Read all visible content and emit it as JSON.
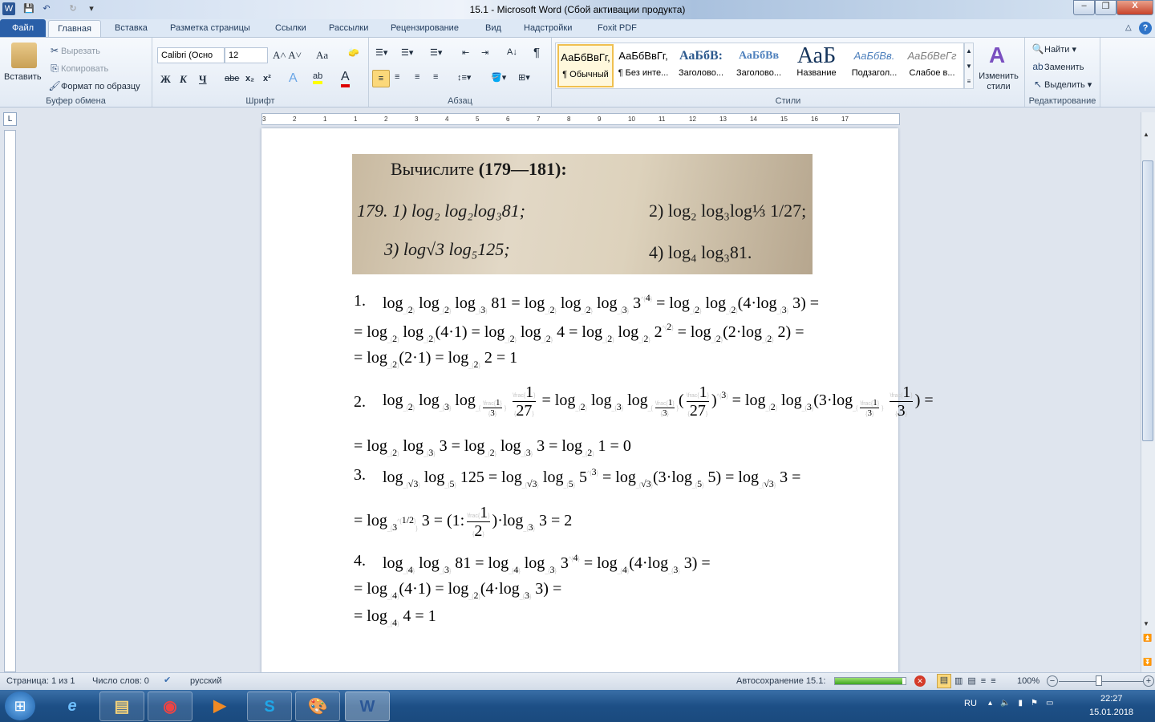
{
  "window": {
    "title": "15.1  -  Microsoft Word (Сбой активации продукта)",
    "min": "–",
    "max": "❐",
    "close": "X"
  },
  "tabs": [
    "Файл",
    "Главная",
    "Вставка",
    "Разметка страницы",
    "Ссылки",
    "Рассылки",
    "Рецензирование",
    "Вид",
    "Надстройки",
    "Foxit PDF"
  ],
  "clipboard": {
    "paste": "Вставить",
    "cut": "Вырезать",
    "copy": "Копировать",
    "format": "Формат по образцу",
    "label": "Буфер обмена"
  },
  "font": {
    "name": "Calibri (Осно",
    "size": "12",
    "label": "Шрифт",
    "bold": "Ж",
    "italic": "К",
    "underline": "Ч",
    "strike": "abe",
    "sub": "x₂",
    "sup": "x²",
    "case": "Aa"
  },
  "paragraph": {
    "label": "Абзац",
    "pilcrow": "¶"
  },
  "styles": {
    "label": "Стили",
    "items": [
      {
        "preview": "АаБбВвГг,",
        "name": "¶ Обычный"
      },
      {
        "preview": "АаБбВвГг,",
        "name": "¶ Без инте..."
      },
      {
        "preview": "АаБбВ:",
        "name": "Заголово..."
      },
      {
        "preview": "АаБбВв",
        "name": "Заголово..."
      },
      {
        "preview": "АаБ",
        "name": "Название"
      },
      {
        "preview": "АаБбВв.",
        "name": "Подзагол..."
      },
      {
        "preview": "АаБбВеГг",
        "name": "Слабое в..."
      }
    ],
    "change": "Изменить стили"
  },
  "editing": {
    "label": "Редактирование",
    "find": "Найти",
    "replace": "Заменить",
    "select": "Выделить"
  },
  "ruler_numbers": [
    "3",
    "2",
    "1",
    "1",
    "2",
    "3",
    "4",
    "5",
    "6",
    "7",
    "8",
    "9",
    "10",
    "11",
    "12",
    "13",
    "14",
    "15",
    "16",
    "17"
  ],
  "photo": {
    "heading": "Вычислите",
    "range": "(179—181):",
    "l1a": "179. 1) log₂ log₂log₃81;",
    "l1b": "2) log₂ log₃log⅓ 1/27;",
    "l2a": "3) log√3  log₅125;",
    "l2b": "4) log₄ log₃81."
  },
  "solutions": [
    {
      "num": "1.",
      "lines": [
        "log_{2} log_{2} log_{3} 81 = log_{2} log_{2} log_{3} 3^{4} = log_{2} log_{2}(4·log_{3} 3) =",
        "= log_{2} log_{2}(4·1) = log_{2} log_{2} 4 = log_{2} log_{2} 2^{2} = log_{2}(2·log_{2} 2) =",
        "= log_{2}(2·1) = log_{2} 2 = 1"
      ]
    },
    {
      "num": "2.",
      "lines": [
        "log_{2} log_{3} log_{\\frac{1}{3}} \\frac{1}{27} = log_{2} log_{3} log_{\\frac{1}{3}}(\\frac{1}{27})^{3} = log_{2} log_{3}(3·log_{\\frac{1}{3}} \\frac{1}{3}) =",
        "= log_{2} log_{3} 3 = log_{2} log_{3} 3 = log_{2} 1 = 0"
      ]
    },
    {
      "num": "3.",
      "lines": [
        "log_{√3} log_{5} 125 = log_{√3} log_{5} 5^{3} = log_{√3}(3·log_{5} 5) = log_{√3} 3 =",
        "= log_{3^{1/2}} 3 = (1:\\frac{1}{2})·log_{3} 3 = 2"
      ]
    },
    {
      "num": "4.",
      "lines": [
        "log_{4} log_{3} 81 = log_{4} log_{3} 3^{4} = log_{4}(4·log_{3} 3) =",
        "= log_{4}(4·1) = log_{2}(4·log_{3} 3) =",
        "= log_{4} 4 = 1"
      ]
    }
  ],
  "status": {
    "page": "Страница: 1 из 1",
    "words": "Число слов: 0",
    "lang": "русский",
    "autosave": "Автосохранение 15.1:",
    "autosave_progress": 0.95,
    "zoom": "100%"
  },
  "tray": {
    "lang": "RU",
    "time": "22:27",
    "date": "15.01.2018"
  }
}
